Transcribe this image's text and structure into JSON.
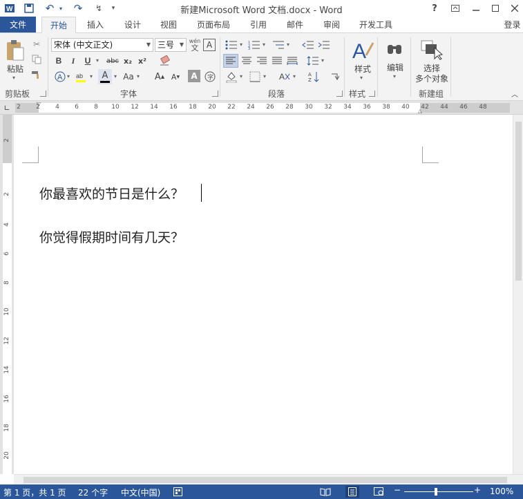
{
  "window": {
    "title": "新建Microsoft Word 文档.docx - Word",
    "help_icon": "?",
    "restore_icon": "ribbon-display-icon",
    "minimize_icon": "minimize-icon",
    "maximize_icon": "maximize-icon",
    "close_icon": "close-icon"
  },
  "tabs": [
    {
      "label": "文件"
    },
    {
      "label": "开始"
    },
    {
      "label": "插入"
    },
    {
      "label": "设计"
    },
    {
      "label": "视图"
    },
    {
      "label": "页面布局"
    },
    {
      "label": "引用"
    },
    {
      "label": "邮件"
    },
    {
      "label": "审阅"
    },
    {
      "label": "开发工具"
    }
  ],
  "signin": "登录",
  "ribbon": {
    "clipboard": {
      "paste": "粘贴",
      "group": "剪贴板"
    },
    "font": {
      "font_name": "宋体 (中文正文)",
      "font_size": "三号",
      "wen": "wén",
      "wen_char": "文",
      "box_a": "A",
      "bold": "B",
      "italic": "I",
      "underline": "U",
      "strike": "abc",
      "subscript": "x₂",
      "superscript": "x²",
      "font_color": "A",
      "change_case": "Aa",
      "group": "字体"
    },
    "paragraph": {
      "group": "段落"
    },
    "styles": {
      "label": "样式",
      "group": "样式"
    },
    "editing": {
      "label": "编辑"
    },
    "newgroup": {
      "label1": "选择",
      "label2": "多个对象",
      "group": "新建组"
    }
  },
  "ruler": {
    "h_ticks": [
      "2",
      "2",
      "4",
      "6",
      "8",
      "10",
      "12",
      "14",
      "16",
      "18",
      "20",
      "22",
      "24",
      "26",
      "28",
      "30",
      "32",
      "34",
      "36",
      "38",
      "40",
      "42",
      "44",
      "46",
      "48"
    ],
    "v_ticks": [
      "2",
      "2",
      "4",
      "6",
      "8",
      "10",
      "12",
      "14",
      "16",
      "18",
      "20"
    ]
  },
  "document": {
    "lines": [
      "你最喜欢的节日是什么？",
      "你觉得假期时间有几天？"
    ]
  },
  "status": {
    "page": "第 1 页，共 1 页",
    "words": "22 个字",
    "language": "中文(中国)",
    "zoom": "100%",
    "zoom_minus": "−",
    "zoom_plus": "+"
  },
  "colors": {
    "accent": "#2b579a",
    "ribbon_bg": "#f3f3f3"
  }
}
